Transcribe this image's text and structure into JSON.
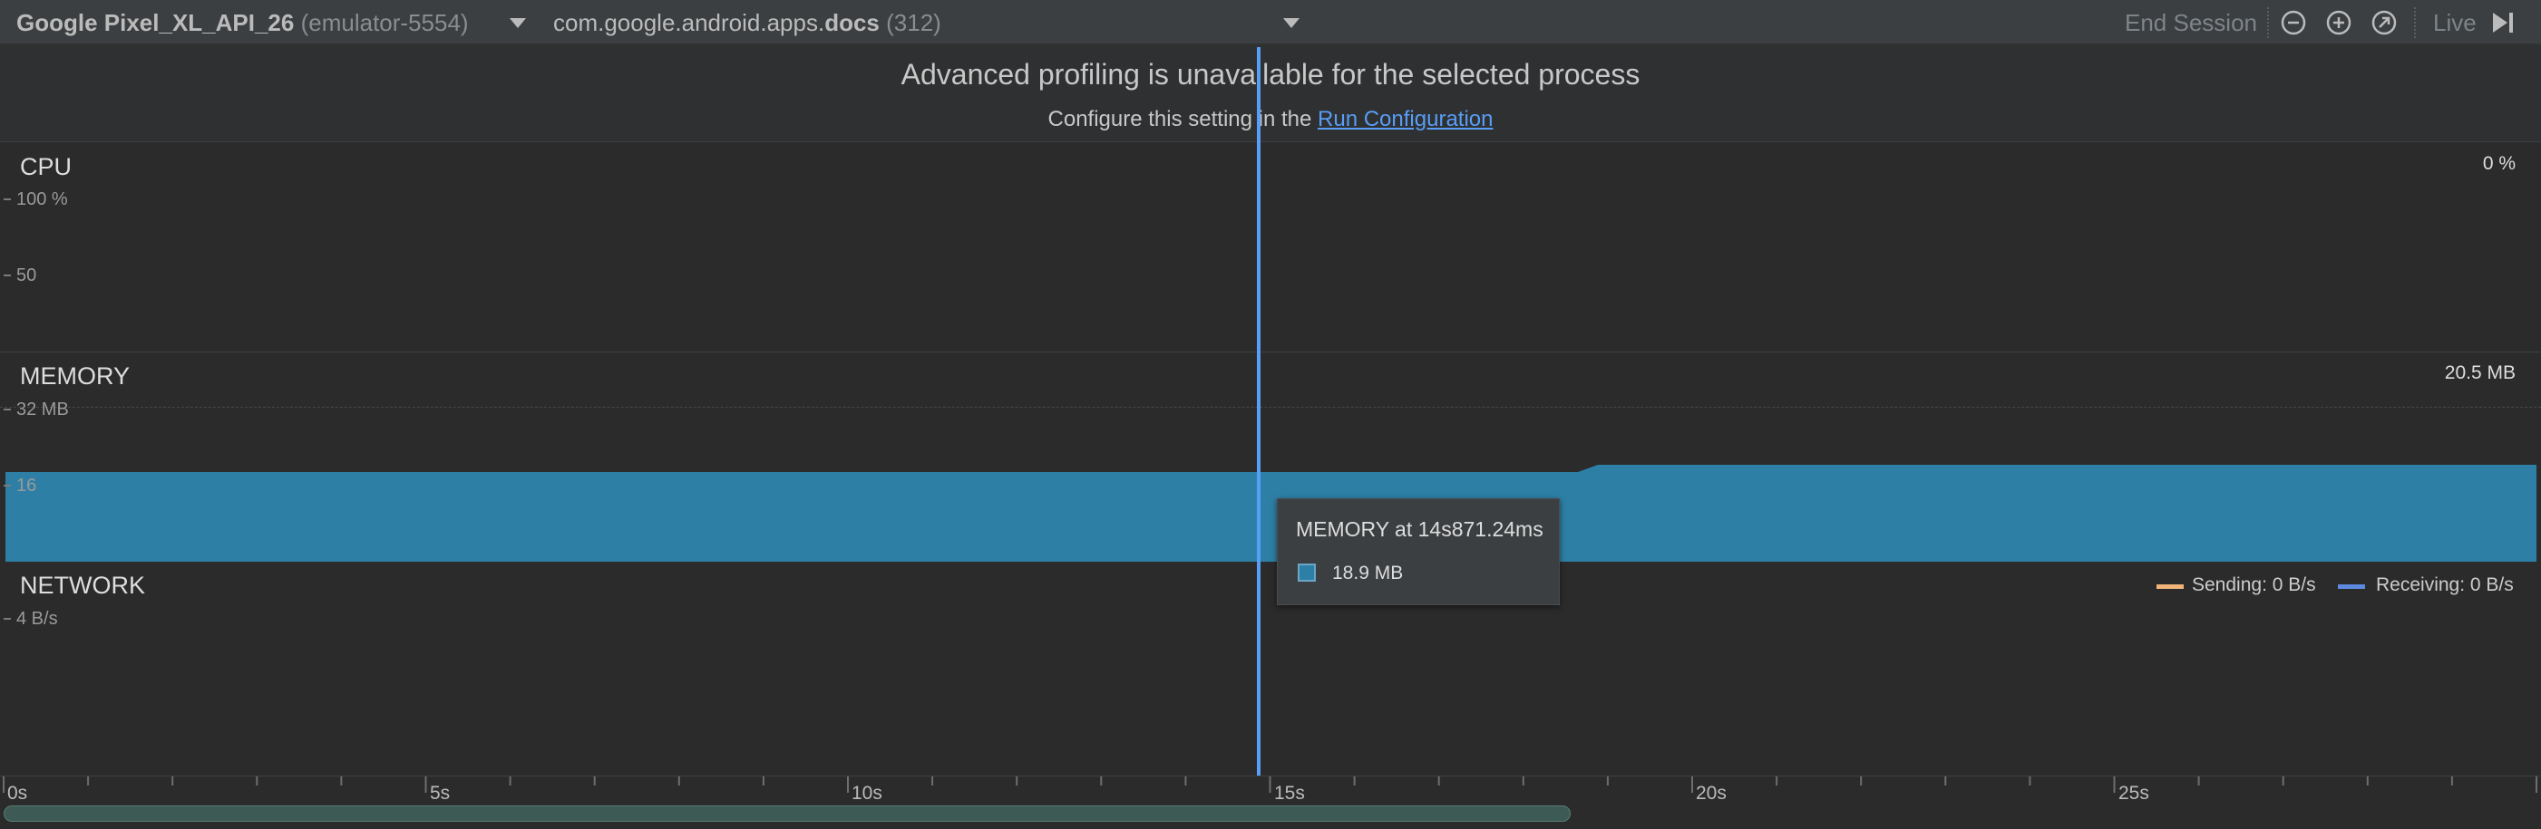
{
  "toolbar": {
    "device_name": "Google Pixel_XL_API_26",
    "device_serial": "(emulator-5554)",
    "process_name": "com.google.android.apps.",
    "process_name_bold": "docs",
    "process_pid": "(312)",
    "end_session": "End Session",
    "live_label": "Live",
    "icons": [
      "zoom-out-icon",
      "zoom-in-icon",
      "reset-zoom-icon",
      "jump-to-live-icon"
    ]
  },
  "banner": {
    "title": "Advanced profiling is unavailable for the selected process",
    "subtitle_prefix": "Configure this setting in the ",
    "link_text": "Run Configuration"
  },
  "cpu": {
    "title": "CPU",
    "current_value": "0 %",
    "ticks": [
      "100 %",
      "50"
    ]
  },
  "memory": {
    "title": "MEMORY",
    "current_value": "20.5 MB",
    "ticks": [
      "32 MB",
      "16"
    ],
    "area_color": "#2e7fa6",
    "series_mb": [
      16.9,
      16.9,
      16.9,
      18.7,
      18.7
    ]
  },
  "network": {
    "title": "NETWORK",
    "ticks": [
      "4 B/s"
    ],
    "legend": [
      {
        "label": "Sending: 0 B/s",
        "color": "#f0b47a"
      },
      {
        "label": "Receiving: 0 B/s",
        "color": "#5b8ae0"
      }
    ]
  },
  "tooltip": {
    "title": "MEMORY at 14s871.24ms",
    "value": "18.9 MB"
  },
  "timeline": {
    "labels": [
      "0s",
      "5s",
      "10s",
      "15s",
      "20s",
      "25s"
    ],
    "cursor_color": "#589df6"
  }
}
